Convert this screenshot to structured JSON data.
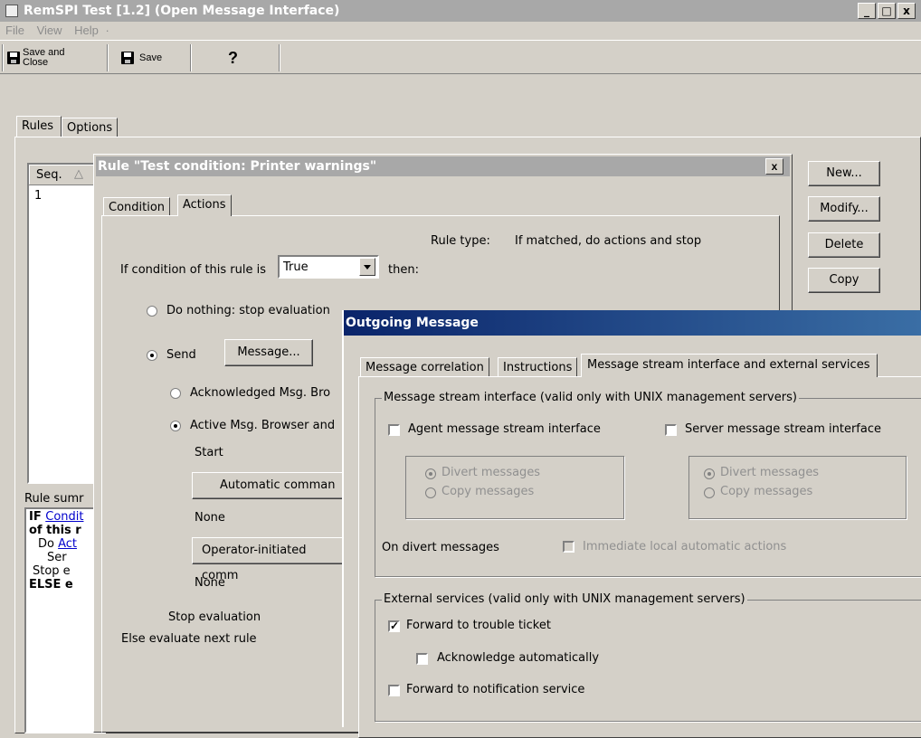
{
  "window": {
    "title": "RemSPI Test [1.2]  (Open Message Interface)",
    "minimize": "_",
    "maximize": "□",
    "close": "x"
  },
  "menu": [
    "File",
    "View",
    "Help",
    "·"
  ],
  "toolbar": {
    "save_close_line1": "Save and",
    "save_close_line2": "Close",
    "save": "Save",
    "help_glyph": "?"
  },
  "main_tabs": [
    "Rules",
    "Options"
  ],
  "rules_table": {
    "col_seq": "Seq.",
    "sort_arrow": "△",
    "rows": [
      "1"
    ]
  },
  "side_buttons": [
    "New...",
    "Modify...",
    "Delete",
    "Copy"
  ],
  "rule_summary": {
    "label": "Rule sumr",
    "lines": [
      {
        "prefix": "IF ",
        "link": "Condit"
      },
      {
        "prefix": "of this r",
        "link": ""
      },
      {
        "prefix": "Do ",
        "link": "Act"
      },
      {
        "prefix": "Ser",
        "link": ""
      },
      {
        "prefix": "Stop e",
        "link": ""
      },
      {
        "prefix": "ELSE e",
        "link": ""
      }
    ]
  },
  "rule_dialog": {
    "title": "Rule \"Test condition: Printer warnings\"",
    "close": "x",
    "tabs": [
      "Condition",
      "Actions"
    ],
    "rule_type_label": "Rule type:",
    "rule_type_value": "If matched, do actions and stop",
    "if_condition_label": "If condition of this rule is",
    "condition_value": "True",
    "then": "then:",
    "do_nothing": "Do nothing: stop evaluation",
    "send": "Send",
    "message_btn": "Message...",
    "ack_browser": "Acknowledged Msg. Bro",
    "active_browser": "Active Msg. Browser and",
    "start": "Start",
    "automatic_btn": "Automatic comman",
    "none1": "None",
    "operator_btn": "Operator-initiated comm",
    "none2": "None",
    "stop_eval": "Stop evaluation",
    "else_eval": "Else evaluate next rule"
  },
  "outgoing": {
    "title": "Outgoing Message",
    "tabs": [
      "Message correlation",
      "Instructions",
      "Message stream interface and external services"
    ],
    "msi_group": "Message stream interface (valid only with UNIX management servers)",
    "agent_msi": "Agent message stream interface",
    "server_msi": "Server message stream interface",
    "divert": "Divert messages",
    "copy": "Copy messages",
    "on_divert": "On divert messages",
    "immediate": "Immediate local automatic actions",
    "ext_group": "External services (valid only with UNIX management servers)",
    "forward_tt": "Forward to trouble ticket",
    "ack_auto": "Acknowledge automatically",
    "forward_ns": "Forward to notification service",
    "check_mark": "✓"
  },
  "colors": {
    "title_active": "#0a246a",
    "title_inactive": "#a8a8a8",
    "face": "#d4d0c8"
  }
}
